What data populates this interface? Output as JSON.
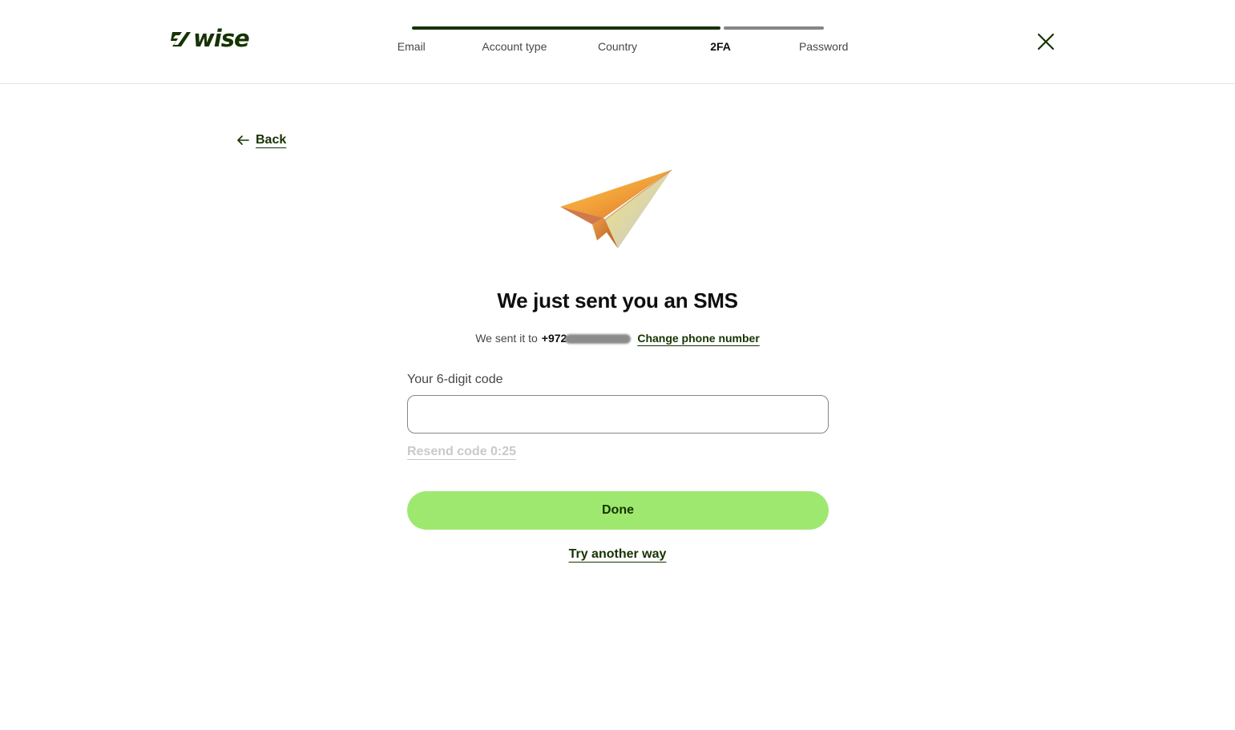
{
  "brand": {
    "name": "wise",
    "color": "#163300",
    "accent": "#9fe870"
  },
  "stepper": {
    "steps": [
      {
        "label": "Email"
      },
      {
        "label": "Account type"
      },
      {
        "label": "Country"
      },
      {
        "label": "2FA"
      },
      {
        "label": "Password"
      }
    ],
    "active_step": "2FA",
    "progress_fraction": 0.75
  },
  "header": {
    "close_icon": "close-icon"
  },
  "back": {
    "label": "Back",
    "icon": "arrow-left-icon"
  },
  "illustration": "paper-plane",
  "main": {
    "title": "We just sent you an SMS",
    "sent_prefix": "We sent it to",
    "phone_visible": "+972",
    "change_phone_label": "Change phone number",
    "code_label": "Your 6-digit code",
    "code_value": "",
    "resend_label": "Resend code 0:25",
    "done_label": "Done",
    "try_another_label": "Try another way"
  }
}
